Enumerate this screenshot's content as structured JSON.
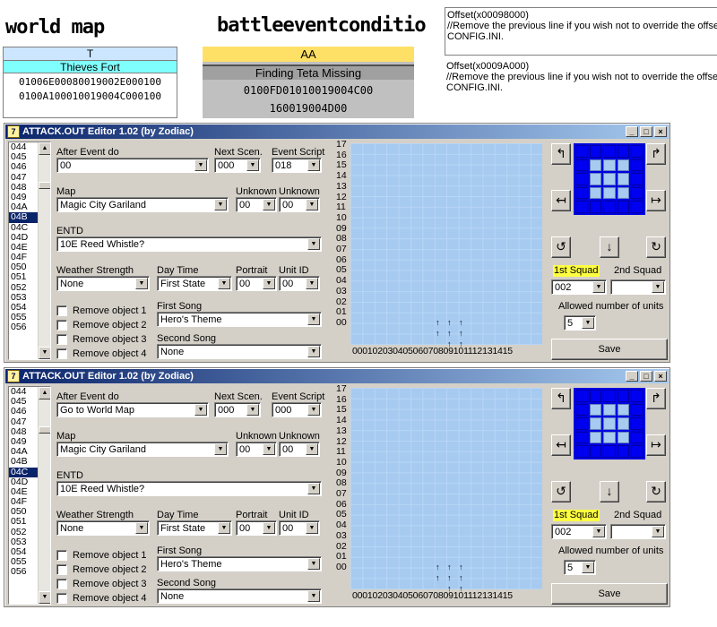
{
  "top": {
    "world_map_title": "world map",
    "battle_title": "battleeventconditio",
    "world_header": "T",
    "world_row_name": "Thieves Fort",
    "world_row_hex1": "01006E00080019002E000100",
    "world_row_hex2": "0100A100010019004C000100",
    "battle_header": "AA",
    "battle_row_name": "Finding Teta Missing",
    "battle_row_hex1": "0100FD01010019004C00",
    "battle_row_hex2": "160019004D00",
    "note1_line1": "Offset(x00098000)",
    "note1_line2": "//Remove the previous line if you wish not to override the offset in",
    "note1_line3": "CONFIG.INI.",
    "note2_line1": "Offset(x0009A000)",
    "note2_line2": "//Remove the previous line if you wish not to override the offset in",
    "note2_line3": "CONFIG.INI.",
    "colors": {
      "world_header_bg": "#cce6ff",
      "world_name_bg": "#80ffff",
      "battle_header_bg": "#ffe066",
      "battle_name_bg": "#a0a0a0",
      "battle_hex_bg": "#c0c0c0"
    }
  },
  "labels": {
    "title": "ATTACK.OUT Editor 1.02 (by Zodiac)",
    "after_event_do": "After Event do",
    "next_scen": "Next Scen.",
    "event_script": "Event Script",
    "map": "Map",
    "unknown1": "Unknown",
    "unknown2": "Unknown",
    "entd": "ENTD",
    "weather_strength": "Weather Strength",
    "day_time": "Day Time",
    "portrait": "Portrait",
    "unit_id": "Unit ID",
    "remove_object_1": "Remove object 1",
    "remove_object_2": "Remove object 2",
    "remove_object_3": "Remove object 3",
    "remove_object_4": "Remove object 4",
    "first_song": "First Song",
    "second_song": "Second Song",
    "first_squad": "1st Squad",
    "second_squad": "2nd Squad",
    "allowed_units": "Allowed number of units",
    "save": "Save",
    "col_labels": "00010203040506070809101112131415",
    "minimize": "_",
    "maximize": "□",
    "close": "×",
    "app_icon": "7"
  },
  "row_labels": [
    "17",
    "16",
    "15",
    "14",
    "13",
    "12",
    "11",
    "10",
    "09",
    "08",
    "07",
    "06",
    "05",
    "04",
    "03",
    "02",
    "01",
    "00"
  ],
  "editor1": {
    "list_items": [
      "044",
      "045",
      "046",
      "047",
      "048",
      "049",
      "04A",
      "04B",
      "04C",
      "04D",
      "04E",
      "04F",
      "050",
      "051",
      "052",
      "053",
      "054",
      "055",
      "056"
    ],
    "selected": "04B",
    "after_event_do": "00",
    "next_scen": "000",
    "event_script": "018",
    "map": "Magic City Gariland",
    "unknown1": "00",
    "unknown2": "00",
    "entd": "10E Reed Whistle?",
    "weather_strength": "None",
    "day_time": "First State",
    "portrait": "00",
    "unit_id": "00",
    "first_song": "Hero's Theme",
    "second_song": "None",
    "first_squad": "002",
    "second_squad": "",
    "allowed_units": "5"
  },
  "editor2": {
    "list_items": [
      "044",
      "045",
      "046",
      "047",
      "048",
      "049",
      "04A",
      "04B",
      "04C",
      "04D",
      "04E",
      "04F",
      "050",
      "051",
      "052",
      "053",
      "054",
      "055",
      "056"
    ],
    "selected": "04C",
    "after_event_do": "Go to World Map",
    "next_scen": "000",
    "event_script": "000",
    "map": "Magic City Gariland",
    "unknown1": "00",
    "unknown2": "00",
    "entd": "10E Reed Whistle?",
    "weather_strength": "None",
    "day_time": "First State",
    "portrait": "00",
    "unit_id": "00",
    "first_song": "Hero's Theme",
    "second_song": "None",
    "first_squad": "002",
    "second_squad": "",
    "allowed_units": "5"
  },
  "icons": {
    "arrow_up_left": "↰",
    "arrow_up": "↑",
    "arrow_up_right": "↱",
    "arrow_left": "↤",
    "arrow_right": "↦",
    "rotate_left": "↺",
    "arrow_down": "↓",
    "rotate_right": "↻",
    "unit_marker": "↑",
    "dropdown": "▼",
    "scroll_up": "▲",
    "scroll_down": "▼"
  }
}
